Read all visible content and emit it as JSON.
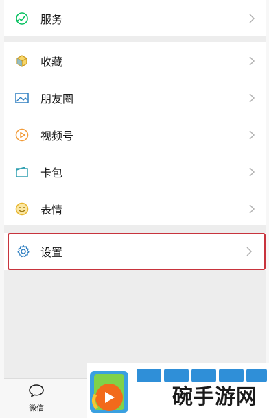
{
  "menu": {
    "services": {
      "label": "服务",
      "icon": "services-icon"
    },
    "favorites": {
      "label": "收藏",
      "icon": "favorites-cube-icon"
    },
    "moments": {
      "label": "朋友圈",
      "icon": "moments-image-icon"
    },
    "channels": {
      "label": "视频号",
      "icon": "channels-play-icon"
    },
    "cards": {
      "label": "卡包",
      "icon": "card-wallet-icon"
    },
    "stickers": {
      "label": "表情",
      "icon": "sticker-smile-icon"
    },
    "settings": {
      "label": "设置",
      "icon": "gear-icon"
    }
  },
  "tabbar": {
    "chats": {
      "label": "微信",
      "icon": "chat-bubble-icon"
    }
  },
  "watermark": {
    "text": "碗手游网"
  },
  "colors": {
    "background": "#ededed",
    "row": "#ffffff",
    "highlight": "#c8343d",
    "icon_green": "#07c160",
    "icon_blue": "#2f7fc1",
    "icon_orange": "#f29b38",
    "icon_yellow": "#e8b52b"
  }
}
